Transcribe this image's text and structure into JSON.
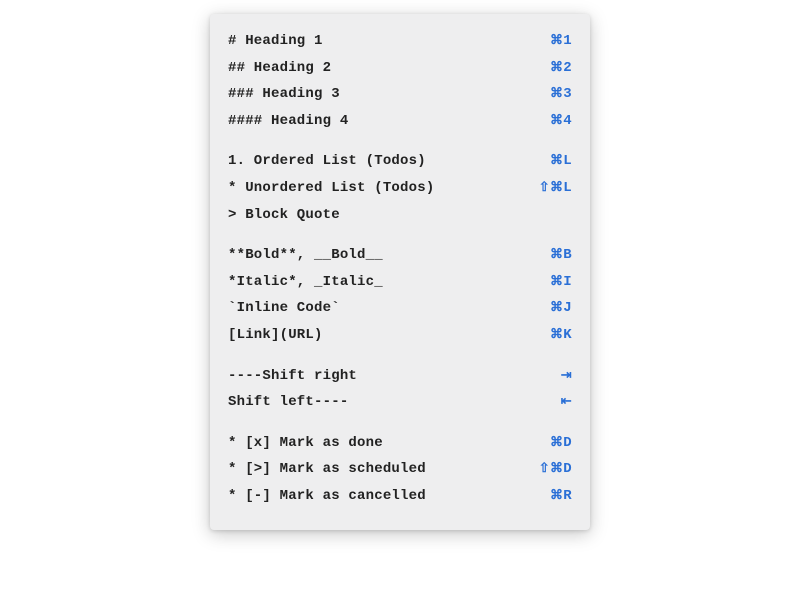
{
  "sections": [
    {
      "rows": [
        {
          "label": "# Heading 1",
          "shortcut": "⌘1"
        },
        {
          "label": "## Heading 2",
          "shortcut": "⌘2"
        },
        {
          "label": "### Heading 3",
          "shortcut": "⌘3"
        },
        {
          "label": "#### Heading 4",
          "shortcut": "⌘4"
        }
      ]
    },
    {
      "rows": [
        {
          "label": "1. Ordered List (Todos)",
          "shortcut": "⌘L"
        },
        {
          "label": "* Unordered List (Todos)",
          "shortcut": "⇧⌘L"
        },
        {
          "label": "> Block Quote",
          "shortcut": ""
        }
      ]
    },
    {
      "rows": [
        {
          "label": "**Bold**, __Bold__",
          "shortcut": "⌘B"
        },
        {
          "label": "*Italic*, _Italic_",
          "shortcut": "⌘I"
        },
        {
          "label": "`Inline Code`",
          "shortcut": "⌘J"
        },
        {
          "label": "[Link](URL)",
          "shortcut": "⌘K"
        }
      ]
    },
    {
      "rows": [
        {
          "label": "----Shift right",
          "shortcut": "⇥"
        },
        {
          "label": "Shift left----",
          "shortcut": "⇤"
        }
      ]
    },
    {
      "rows": [
        {
          "label": "* [x] Mark as done",
          "shortcut": "⌘D"
        },
        {
          "label": "* [>] Mark as scheduled",
          "shortcut": "⇧⌘D"
        },
        {
          "label": "* [-] Mark as cancelled",
          "shortcut": "⌘R"
        }
      ]
    }
  ]
}
